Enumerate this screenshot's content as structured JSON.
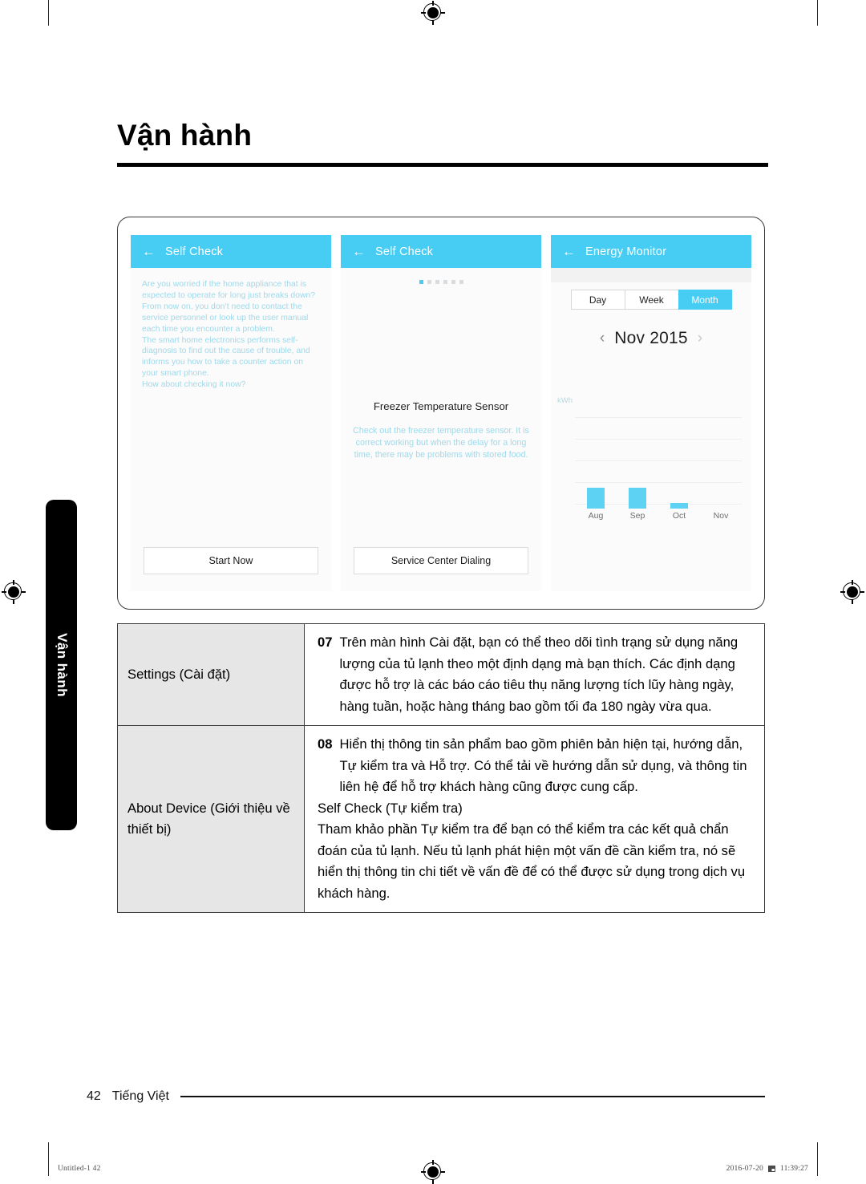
{
  "page": {
    "title": "Vận hành",
    "side_tab_label": "Vận hành",
    "page_number": "42",
    "language_footer": "Tiếng Việt"
  },
  "print_marks": {
    "file_label": "Untitled-1   42",
    "timestamp": "2016-07-20",
    "time": "11:39:27"
  },
  "app_figure": {
    "panel_self_check_intro": {
      "appbar_back_icon": "back-arrow-icon",
      "appbar_title": "Self Check",
      "body_text": "Are you worried if the home appliance that is expected to operate for long just breaks down?\nFrom now on, you don’t need to contact the service personnel or look up the user manual each time you encounter a problem.\nThe smart home electronics performs self-diagnosis to find out the cause of trouble, and informs you how to take a counter action on your smart phone.\nHow about checking it now?",
      "cta_label": "Start Now"
    },
    "panel_self_check_result": {
      "appbar_back_icon": "back-arrow-icon",
      "appbar_title": "Self Check",
      "pager_dots_total": 6,
      "pager_dots_active_index": 0,
      "result_title": "Freezer Temperature Sensor",
      "result_description": "Check out the freezer temperature sensor. It is correct working but when the delay for a long time, there may be problems with stored food.",
      "cta_label": "Service Center Dialing"
    },
    "panel_energy_monitor": {
      "appbar_back_icon": "back-arrow-icon",
      "appbar_title": "Energy Monitor",
      "segments": [
        {
          "label": "Day",
          "active": false
        },
        {
          "label": "Week",
          "active": false
        },
        {
          "label": "Month",
          "active": true
        }
      ],
      "month_prev_icon": "chevron-left-icon",
      "month_next_icon": "chevron-right-icon",
      "month_label": "Nov 2015"
    }
  },
  "chart_data": {
    "type": "bar",
    "title": "",
    "categories": [
      "Aug",
      "Sep",
      "Oct",
      "Nov"
    ],
    "values": [
      26,
      26,
      7,
      0
    ],
    "xlabel": "",
    "ylabel": "kWh",
    "ylim": [
      0,
      128
    ],
    "grid": true,
    "gridline_count": 5,
    "legend": "none",
    "bar_color": "#5dd2f2"
  },
  "content_table": {
    "rows": [
      {
        "label": "Settings (Cài đặt)",
        "blocks": [
          {
            "number": "07",
            "text": "Trên màn hình Cài đặt, bạn có thể theo dõi tình trạng sử dụng năng lượng của tủ lạnh theo một định dạng mà bạn thích. Các định dạng được hỗ trợ là các báo cáo tiêu thụ năng lượng tích lũy hàng ngày, hàng tuần, hoặc hàng tháng bao gồm tối đa 180 ngày vừa qua."
          }
        ]
      },
      {
        "label": "About Device (Giới thiệu về thiết bị)",
        "blocks": [
          {
            "number": "08",
            "text": "Hiển thị thông tin sản phẩm bao gồm phiên bản hiện tại, hướng dẫn, Tự kiểm tra và Hỗ trợ. Có thể tải về hướng dẫn sử dụng, và thông tin liên hệ để hỗ trợ khách hàng cũng được cung cấp."
          },
          {
            "number": "",
            "text": "Self Check (Tự kiểm tra)"
          },
          {
            "number": "",
            "text": "Tham khảo phần Tự kiểm tra để bạn có thể kiểm tra các kết quả chẩn đoán của tủ lạnh. Nếu tủ lạnh phát hiện một vấn đề cần kiểm tra, nó sẽ hiển thị thông tin chi tiết về vấn đề để có thể được sử dụng trong dịch vụ khách hàng."
          }
        ]
      }
    ]
  },
  "colors": {
    "accent_cyan": "#47cdf4",
    "bar_cyan": "#5dd2f2",
    "muted_cyan_text": "#9fd9ea",
    "label_cell_bg": "#e6e6e6"
  }
}
